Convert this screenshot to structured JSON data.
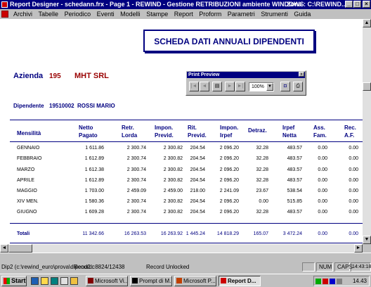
{
  "window": {
    "title": "Report Designer - schedann.frx - Page 1 - REWIND - Gestione RETRIBUZIONI ambiente WINDOWS",
    "zone": "Zona : C:\\REWIND...",
    "buttons": {
      "minimize": "_",
      "maximize": "□",
      "close": "×"
    }
  },
  "menu": [
    "Archivi",
    "Tabelle",
    "Periodico",
    "Eventi",
    "Modelli",
    "Stampe",
    "Report",
    "Proform",
    "Parametri",
    "Strumenti",
    "Guida"
  ],
  "report": {
    "title": "SCHEDA DATI ANNUALI DIPENDENTI",
    "azienda_label": "Azienda",
    "azienda_code": "195",
    "azienda_name": "MHT SRL",
    "dipendente_label": "Dipendente",
    "dipendente_code": "19510002",
    "dipendente_name": "ROSSI MARIO",
    "headers": [
      {
        "l1": "Mensilità",
        "l2": ""
      },
      {
        "l1": "Netto",
        "l2": "Pagato"
      },
      {
        "l1": "Retr.",
        "l2": "Lorda"
      },
      {
        "l1": "Impon.",
        "l2": "Previd."
      },
      {
        "l1": "Rit.",
        "l2": "Previd."
      },
      {
        "l1": "Impon.",
        "l2": "Irpef"
      },
      {
        "l1": "Detraz.",
        "l2": ""
      },
      {
        "l1": "Irpef",
        "l2": "Netta"
      },
      {
        "l1": "Ass.",
        "l2": "Fam."
      },
      {
        "l1": "Rec.",
        "l2": "A.F."
      }
    ],
    "rows": [
      [
        "GENNAIO",
        "1 611.86",
        "2 300.74",
        "2 300.82",
        "204.54",
        "2 096.20",
        "32.28",
        "483.57",
        "0.00",
        "0.00"
      ],
      [
        "FEBBRAIO",
        "1 612.89",
        "2 300.74",
        "2 300.82",
        "204.54",
        "2 096.20",
        "32.28",
        "483.57",
        "0.00",
        "0.00"
      ],
      [
        "MARZO",
        "1 612.38",
        "2 300.74",
        "2 300.82",
        "204.54",
        "2 096.20",
        "32.28",
        "483.57",
        "0.00",
        "0.00"
      ],
      [
        "APRILE",
        "1 612.89",
        "2 300.74",
        "2 300.82",
        "204.54",
        "2 096.20",
        "32.28",
        "483.57",
        "0.00",
        "0.00"
      ],
      [
        "MAGGIO",
        "1 703.00",
        "2 459.09",
        "2 459.00",
        "218.00",
        "2 241.09",
        "23.67",
        "538.54",
        "0.00",
        "0.00"
      ],
      [
        "XIV MEN.",
        "1 580.36",
        "2 300.74",
        "2 300.82",
        "204.54",
        "2 096.20",
        "0.00",
        "515.85",
        "0.00",
        "0.00"
      ],
      [
        "GIUGNO",
        "1 609.28",
        "2 300.74",
        "2 300.82",
        "204.54",
        "2 096.20",
        "32.28",
        "483.57",
        "0.00",
        "0.00"
      ]
    ],
    "totals": [
      "Totali",
      "11 342.66",
      "16 263.53",
      "16 263.92",
      "1 445.24",
      "14 818.29",
      "165.07",
      "3 472.24",
      "0.00",
      "0.00"
    ]
  },
  "print_preview": {
    "title": "Print Preview",
    "zoom": "100%"
  },
  "status": {
    "path": "Dip2 (c:\\rewind_euro\\prova\\dipend2.c",
    "record": "Record: 8824/12438",
    "lock": "Record Unlocked",
    "num": "NUM",
    "caps": "CAPS",
    "time": "14:43:18"
  },
  "taskbar": {
    "start": "Start",
    "tasks": [
      "Microsoft Vi...",
      "Prompt di M...",
      "Microsoft P...",
      "Report D..."
    ],
    "clock": "14.43"
  }
}
